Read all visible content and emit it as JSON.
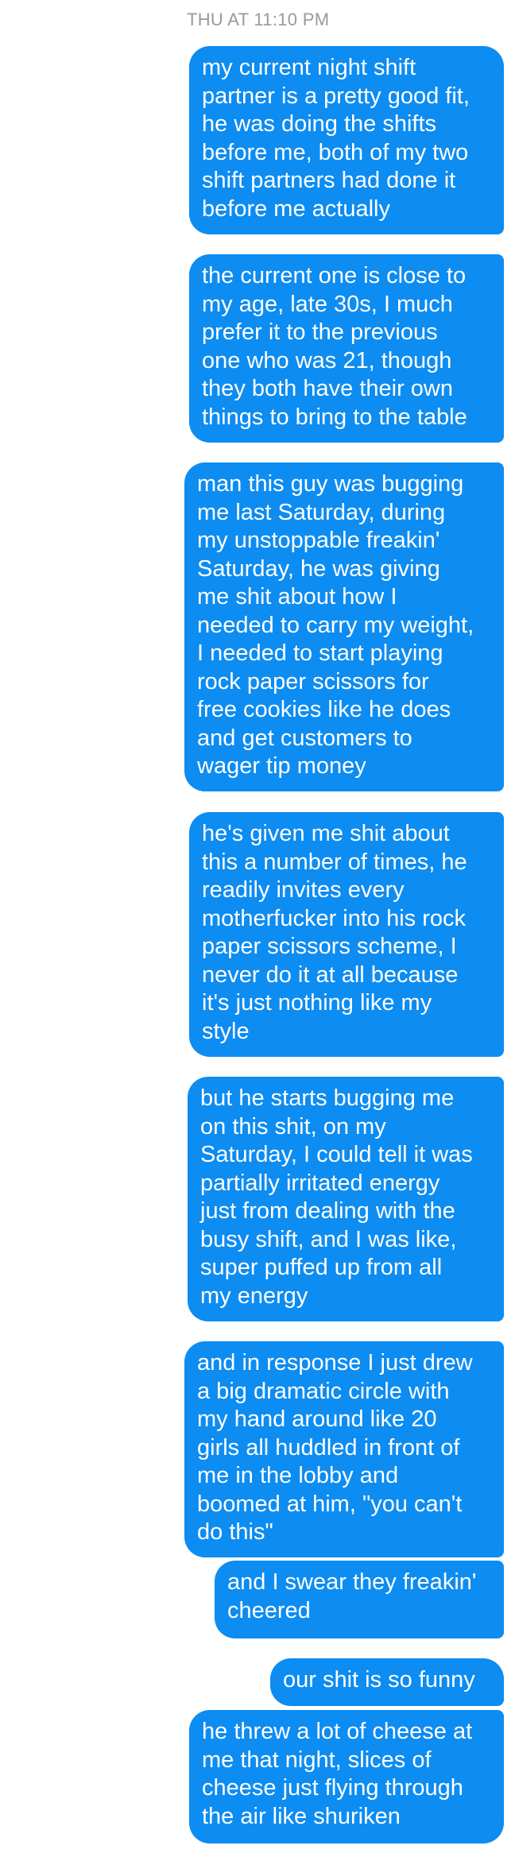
{
  "conversation": {
    "timestamp": "THU AT 11:10 PM",
    "messages": [
      {
        "text": "my current night shift\npartner is a pretty good fit,\nhe was doing the shifts\nbefore me, both of my two\nshift partners had done it\nbefore me actually"
      },
      {
        "text": "the current one is close to\nmy age, late 30s, I much\nprefer it to the previous\none who was 21, though\nthey both have their own\nthings to bring to the table"
      },
      {
        "text": "man this guy was bugging\nme last Saturday, during\nmy unstoppable freakin'\nSaturday, he was giving\nme shit about how I\nneeded to carry my weight,\nI needed to start playing\nrock paper scissors for\nfree cookies like he does\nand get customers to\nwager tip money"
      },
      {
        "text": "he's given me shit about\nthis a number of times, he\nreadily invites every\nmotherfucker into his rock\npaper scissors scheme, I\nnever do it at all because\nit's just nothing like my\nstyle"
      },
      {
        "text": "but he starts bugging me\non this shit, on my\nSaturday, I could tell it was\npartially irritated energy\njust from dealing with the\nbusy shift, and I was like,\nsuper puffed up from all\nmy energy"
      },
      {
        "text": "and in response I just drew\na big dramatic circle with\nmy hand around like 20\ngirls all huddled in front of\nme in the lobby and\nboomed at him, \"you can't\ndo this\""
      },
      {
        "text": "and I swear they freakin'\ncheered"
      },
      {
        "text": "our shit is so funny"
      },
      {
        "text": "he threw a lot of cheese at\nme that night, slices of\ncheese just flying through\nthe air like shuriken"
      }
    ]
  },
  "colors": {
    "bubble": "#0d8cf2",
    "bubble_text": "#ffffff",
    "timestamp": "#9a9a9a",
    "background": "#ffffff"
  }
}
